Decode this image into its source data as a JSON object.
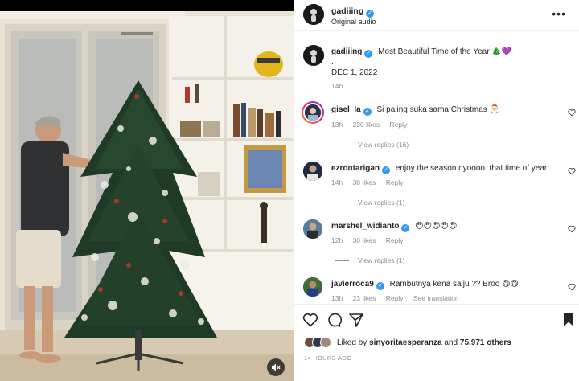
{
  "header": {
    "username": "gadiiing",
    "subtitle": "Original audio",
    "more_label": "•••"
  },
  "caption": {
    "username": "gadiiing",
    "text": "Most Beautiful Time of the Year 🎄💜",
    "dot": ".",
    "date": "DEC 1, 2022",
    "time": "14h"
  },
  "comments": [
    {
      "username": "gisel_la",
      "text": "Si paling suka sama Christmas 🎅",
      "time": "13h",
      "likes": "230 likes",
      "reply": "Reply",
      "view_replies": "View replies (16)"
    },
    {
      "username": "ezrontarigan",
      "text": "enjoy the season nyoooo. that time of year!",
      "time": "14h",
      "likes": "38 likes",
      "reply": "Reply",
      "view_replies": "View replies (1)"
    },
    {
      "username": "marshel_widianto",
      "text": "😍😍😍😍😍",
      "time": "12h",
      "likes": "30 likes",
      "reply": "Reply",
      "view_replies": "View replies (1)"
    },
    {
      "username": "javierroca9",
      "text": "Rambutnya kena salju ?? Broo 😋😋",
      "time": "13h",
      "likes": "23 likes",
      "reply": "Reply",
      "translation": "See translation"
    }
  ],
  "likes": {
    "prefix": "Liked by",
    "user": "sinyoritaesperanza",
    "conj": "and",
    "others": "75,971 others"
  },
  "posted_ago": "14 HOURS AGO",
  "icons": {
    "like": "heart-icon",
    "comment": "comment-icon",
    "share": "paper-plane-icon",
    "save": "bookmark-icon",
    "mute": "speaker-muted-icon",
    "more": "more-dots-icon"
  },
  "colors": {
    "verified": "#3897f0",
    "secondary_text": "#8e8e8e"
  }
}
